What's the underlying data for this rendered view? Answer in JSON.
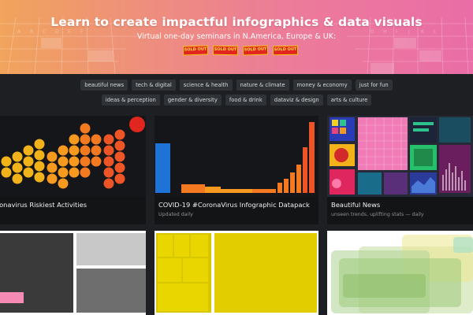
{
  "banner": {
    "title": "Learn to create impactful infographics & data visuals",
    "subtitle": "Virtual one-day seminars in N.America, Europe & UK:",
    "badges": [
      "SOLD OUT",
      "SOLD OUT",
      "SOLD OUT",
      "SOLD OUT"
    ],
    "deco_letters": [
      "A",
      "B",
      "C",
      "D",
      "E",
      "F",
      "G",
      "H",
      "I",
      "J",
      "K",
      "L"
    ],
    "gradient": [
      "#f1a45c",
      "#ea6da7"
    ]
  },
  "tags": {
    "row1": [
      "beautiful news",
      "tech & digital",
      "science & health",
      "nature & climate",
      "money & economy",
      "just for fun"
    ],
    "row2": [
      "ideas & perception",
      "gender & diversity",
      "food & drink",
      "dataviz & design",
      "arts & culture"
    ]
  },
  "cards": [
    {
      "title": "Coronavirus Riskiest Activities",
      "meta": ""
    },
    {
      "title": "COVID-19 #CoronaVirus Infographic Datapack",
      "meta": "Updated daily"
    },
    {
      "title": "Beautiful News",
      "meta": "unseen trends, uplifting stats — daily"
    }
  ],
  "colors": {
    "background": "#1d1f22",
    "card_bg": "#131416",
    "tag_bg": "#2f3236",
    "orange": "#f78f22",
    "red": "#e0261f",
    "yellow": "#e9d000",
    "green_tint": "#b5d69b"
  }
}
